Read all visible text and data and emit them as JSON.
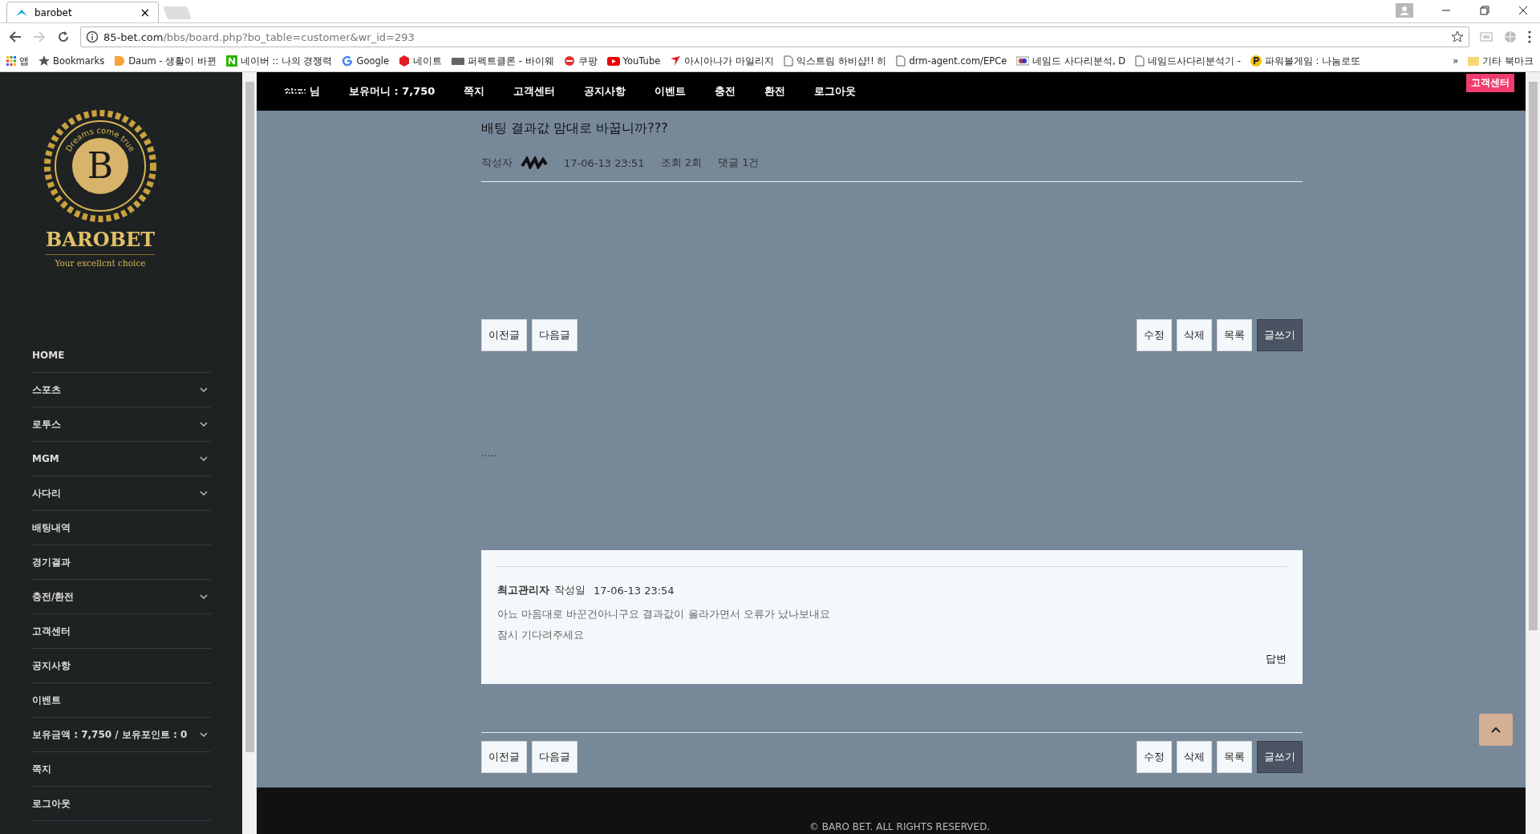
{
  "browser": {
    "tab_title": "barobet",
    "tab_close": "×",
    "url_host": "85-bet.com",
    "url_path": "/bbs/board.php?bo_table=customer&wr_id=293",
    "bookmarks": [
      {
        "kind": "apps",
        "label": "앱"
      },
      {
        "kind": "star",
        "label": "Bookmarks"
      },
      {
        "kind": "daum",
        "label": "Daum - 생활이 바뀐"
      },
      {
        "kind": "naver",
        "label": "네이버 :: 나의 경쟁력"
      },
      {
        "kind": "google",
        "label": "Google"
      },
      {
        "kind": "nate",
        "label": "네이트"
      },
      {
        "kind": "keyboard",
        "label": "퍼펙트클론 - 바이웨"
      },
      {
        "kind": "coupang",
        "label": "쿠팡"
      },
      {
        "kind": "youtube",
        "label": "YouTube"
      },
      {
        "kind": "asiana",
        "label": "아시아나가 마일리지"
      },
      {
        "kind": "page",
        "label": "익스트림 하비샵!! 히"
      },
      {
        "kind": "page",
        "label": "drm-agent.com/EPCe"
      },
      {
        "kind": "flag",
        "label": "네임드 사다리분석, D"
      },
      {
        "kind": "page",
        "label": "네임드사다리분석기 -"
      },
      {
        "kind": "powerball",
        "label": "파워볼게임 : 나눔로또"
      }
    ],
    "more": "»",
    "other_bookmarks": "기타 북마크"
  },
  "logo": {
    "motto": "Dreams come true",
    "letter": "B",
    "name": "BAROBET",
    "tagline": "Your excellcnt choice"
  },
  "sidebar": [
    {
      "label": "HOME",
      "has_submenu": false
    },
    {
      "label": "스포츠",
      "has_submenu": true
    },
    {
      "label": "로투스",
      "has_submenu": true
    },
    {
      "label": "MGM",
      "has_submenu": true
    },
    {
      "label": "사다리",
      "has_submenu": true
    },
    {
      "label": "배팅내역",
      "has_submenu": false
    },
    {
      "label": "경기결과",
      "has_submenu": false
    },
    {
      "label": "충전/환전",
      "has_submenu": true
    },
    {
      "label": "고객센터",
      "has_submenu": false
    },
    {
      "label": "공지사항",
      "has_submenu": false
    },
    {
      "label": "이벤트",
      "has_submenu": false
    },
    {
      "label": "보유금액 : 7,750 / 보유포인트 : 0",
      "has_submenu": true
    },
    {
      "label": "쪽지",
      "has_submenu": false
    },
    {
      "label": "로그아웃",
      "has_submenu": false
    }
  ],
  "topnav": {
    "user_suffix": "님",
    "items": [
      "보유머니 : 7,750",
      "쪽지",
      "고객센터",
      "공지사항",
      "이벤트",
      "충전",
      "환전",
      "로그아웃"
    ],
    "badge": "고객센터"
  },
  "post": {
    "title": "배팅 결과값 맘대로 바꿉니까???",
    "author_label": "작성자",
    "date": "17-06-13 23:51",
    "views": "조회 2회",
    "comments": "댓글 1건",
    "body": "....."
  },
  "button_bars": [
    {
      "left": [
        {
          "label": "이전글",
          "primary": false
        },
        {
          "label": "다음글",
          "primary": false
        }
      ],
      "right": [
        {
          "label": "수정",
          "primary": false
        },
        {
          "label": "삭제",
          "primary": false
        },
        {
          "label": "목록",
          "primary": false
        },
        {
          "label": "글쓰기",
          "primary": true
        }
      ]
    },
    {
      "left": [
        {
          "label": "이전글",
          "primary": false
        },
        {
          "label": "다음글",
          "primary": false
        }
      ],
      "right": [
        {
          "label": "수정",
          "primary": false
        },
        {
          "label": "삭제",
          "primary": false
        },
        {
          "label": "목록",
          "primary": false
        },
        {
          "label": "글쓰기",
          "primary": true
        }
      ]
    }
  ],
  "comment": {
    "author": "최고관리자",
    "date_label": "작성일",
    "date": "17-06-13 23:54",
    "lines": [
      "아뇨 마음대로 바꾼건아니구요 결과값이 올라가면서 오류가 났나보내요",
      "잠시 기다려주세요"
    ],
    "reply": "답변"
  },
  "footer": "© BARO BET. ALL RIGHTS RESERVED."
}
